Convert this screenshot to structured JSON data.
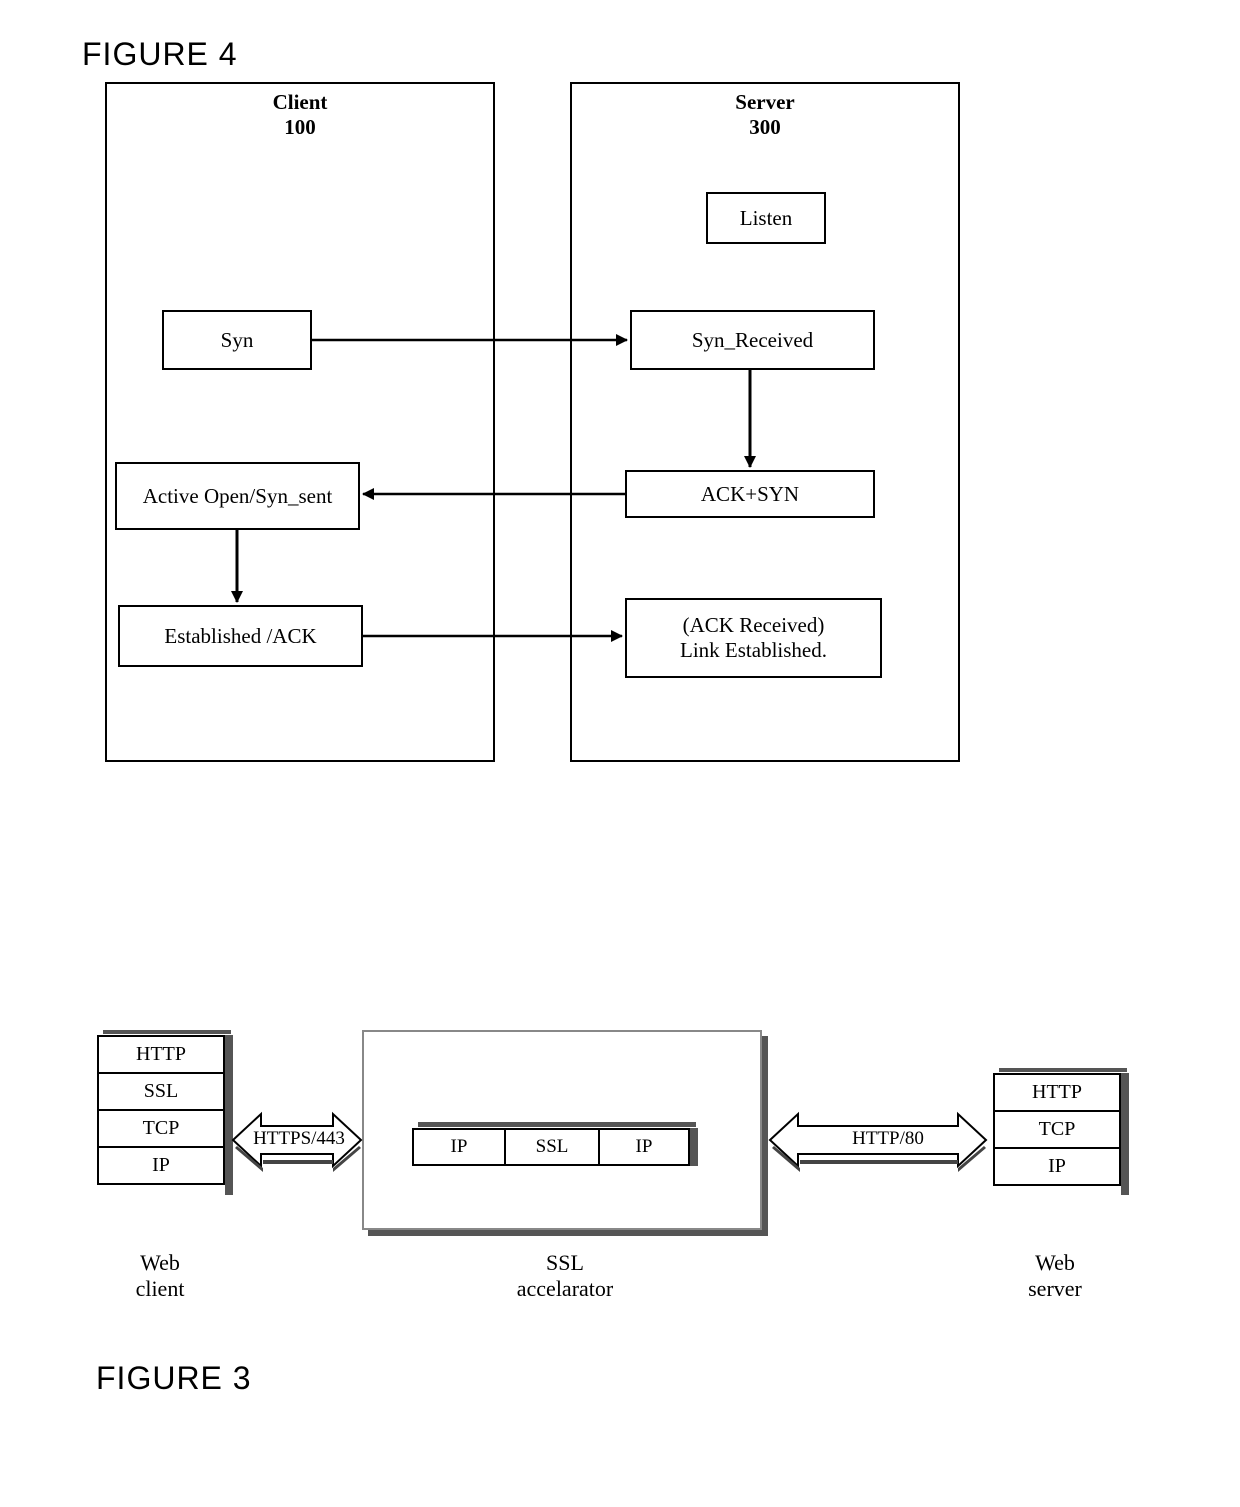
{
  "figure4": {
    "title": "FIGURE 4",
    "client": {
      "name": "Client",
      "id": "100"
    },
    "server": {
      "name": "Server",
      "id": "300"
    },
    "boxes": {
      "listen": "Listen",
      "syn": "Syn",
      "syn_received": "Syn_Received",
      "active_open": "Active Open/Syn_sent",
      "ack_syn": "ACK+SYN",
      "established": "Established /ACK",
      "ack_received_a": "(ACK Received)",
      "ack_received_b": "Link Established."
    }
  },
  "figure3": {
    "title": "FIGURE 3",
    "web_client": {
      "label": "Web\nclient",
      "layers": [
        "HTTP",
        "SSL",
        "TCP",
        "IP"
      ]
    },
    "ssl_accel": {
      "label": "SSL\naccelarator",
      "row": [
        "IP",
        "SSL",
        "IP"
      ]
    },
    "web_server": {
      "label": "Web\nserver",
      "layers": [
        "HTTP",
        "TCP",
        "IP"
      ]
    },
    "arrows": {
      "left": "HTTPS/443",
      "right": "HTTP/80"
    }
  }
}
